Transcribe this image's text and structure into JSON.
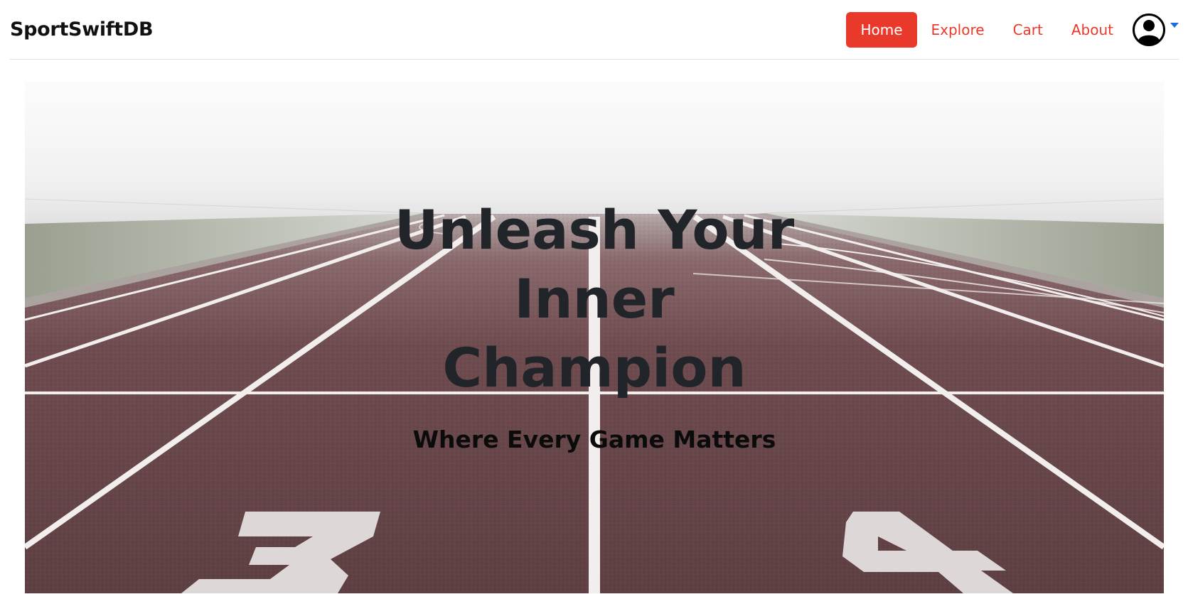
{
  "navbar": {
    "brand": "SportSwiftDB",
    "links": [
      {
        "label": "Home",
        "active": true
      },
      {
        "label": "Explore",
        "active": false
      },
      {
        "label": "Cart",
        "active": false
      },
      {
        "label": "About",
        "active": false
      }
    ],
    "profile_icon": "user-circle-icon",
    "dropdown_icon": "caret-down-icon"
  },
  "hero": {
    "title_lines": [
      "Unleash Your",
      "Inner",
      "Champion"
    ],
    "subtitle": "Where Every Game Matters",
    "background": "running-track-image",
    "lane_numbers": [
      "3",
      "4"
    ]
  },
  "colors": {
    "accent": "#e8392a",
    "caret": "#1a6ee0",
    "text_dark": "#212529",
    "track": "#6b4a4c"
  }
}
